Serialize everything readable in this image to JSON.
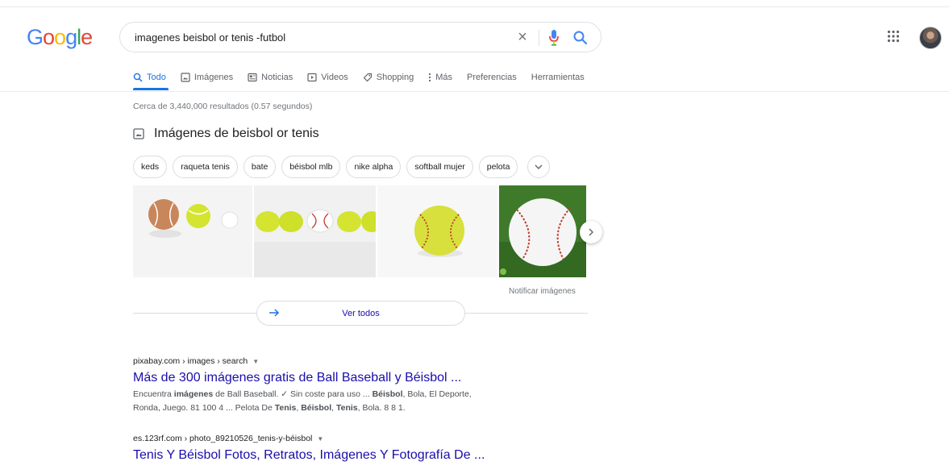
{
  "header": {
    "logo": [
      "G",
      "o",
      "o",
      "g",
      "l",
      "e"
    ],
    "logo_colors": [
      "#4285F4",
      "#EA4335",
      "#FBBC05",
      "#4285F4",
      "#34A853",
      "#EA4335"
    ],
    "query": "imagenes beisbol or tenis -futbol",
    "clear_glyph": "×"
  },
  "tabs": [
    {
      "label": "Todo",
      "icon": "search-icon",
      "active": true
    },
    {
      "label": "Imágenes",
      "icon": "image-icon"
    },
    {
      "label": "Noticias",
      "icon": "news-icon"
    },
    {
      "label": "Videos",
      "icon": "video-icon"
    },
    {
      "label": "Shopping",
      "icon": "tag-icon"
    },
    {
      "label": "Más",
      "icon": "more-vert-icon"
    },
    {
      "label": "Preferencias"
    },
    {
      "label": "Herramientas"
    }
  ],
  "stats": "Cerca de 3,440,000 resultados (0.57 segundos)",
  "images": {
    "title": "Imágenes de beisbol or tenis",
    "chips": [
      "keds",
      "raqueta tenis",
      "bate",
      "béisbol mlb",
      "nike alpha",
      "softball mujer",
      "pelota"
    ],
    "report": "Notificar imágenes",
    "see_all": "Ver todos"
  },
  "results": [
    {
      "cite": "pixabay.com › images › search",
      "title": "Más de 300 imágenes gratis de Ball Baseball y Béisbol ...",
      "snippet_line1": [
        {
          "t": "Encuentra "
        },
        {
          "t": "imágenes",
          "b": true
        },
        {
          "t": " de Ball Baseball. ✓ Sin coste para uso ... "
        },
        {
          "t": "Béisbol",
          "b": true
        },
        {
          "t": ", Bola, El Deporte,"
        }
      ],
      "snippet_line2": [
        {
          "t": "Ronda, Juego. 81 100 4 ... Pelota De "
        },
        {
          "t": "Tenis",
          "b": true
        },
        {
          "t": ", "
        },
        {
          "t": "Béisbol",
          "b": true
        },
        {
          "t": ", "
        },
        {
          "t": "Tenis",
          "b": true
        },
        {
          "t": ", Bola. 8 8 1."
        }
      ]
    },
    {
      "cite": "es.123rf.com › photo_89210526_tenis-y-béisbol",
      "title": "Tenis Y Béisbol Fotos, Retratos, Imágenes Y Fotografía De ..."
    }
  ],
  "colors": {
    "accent": "#1a73e8",
    "link": "#1a0dab",
    "tennis_ball": "#d4e431",
    "stitch_red": "#c0392b",
    "grass": "#3f7a2a"
  }
}
